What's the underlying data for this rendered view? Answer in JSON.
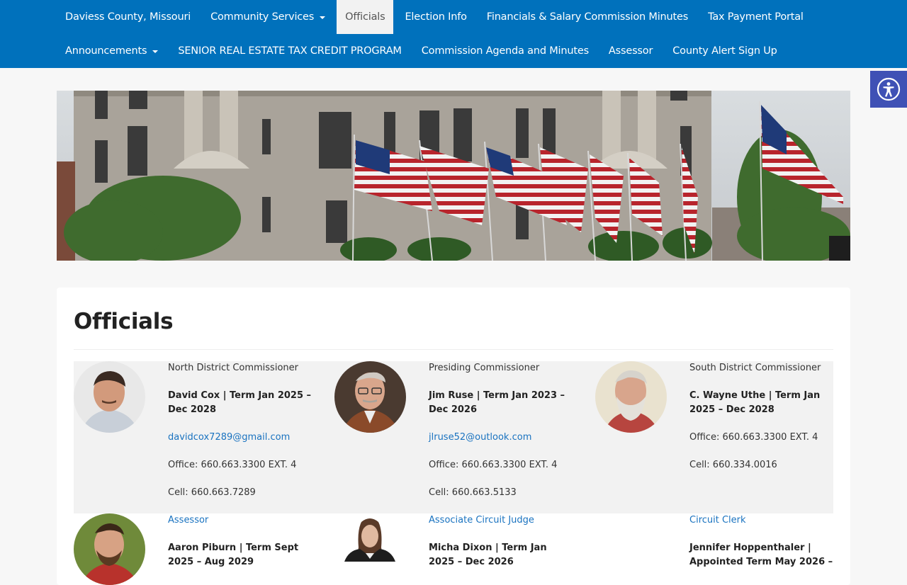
{
  "nav": {
    "row1": [
      {
        "label": "Daviess County, Missouri"
      },
      {
        "label": "Community Services"
      },
      {
        "label": "Officials"
      },
      {
        "label": "Election Info"
      },
      {
        "label": "Financials & Salary Commission Minutes"
      },
      {
        "label": "Tax Payment Portal"
      }
    ],
    "row2": [
      {
        "label": "Announcements"
      },
      {
        "label": "SENIOR REAL ESTATE TAX CREDIT PROGRAM"
      },
      {
        "label": "Commission Agenda and Minutes"
      },
      {
        "label": "Assessor"
      },
      {
        "label": "County Alert Sign Up"
      }
    ]
  },
  "colors": {
    "nav_bg": "#0071bc",
    "link": "#1a73c0",
    "accessibility_bg": "#3f51b5"
  },
  "icons": {
    "accessibility": "accessibility-icon",
    "dropdown": "chevron-down-icon"
  },
  "page": {
    "title": "Officials"
  },
  "officials": [
    {
      "role": "North District Commissioner",
      "name": "David Cox | Term Jan 2025 – Dec 2028",
      "email": "davidcox7289@gmail.com",
      "office": "Office: 660.663.3300 EXT. 4",
      "cell": "Cell: 660.663.7289"
    },
    {
      "role": "Presiding Commissioner",
      "name": "Jim Ruse | Term Jan 2023 – Dec 2026",
      "email": "jlruse52@outlook.com",
      "office": "Office: 660.663.3300 EXT. 4",
      "cell": "Cell: 660.663.5133"
    },
    {
      "role": "South District Commissioner",
      "name": "C. Wayne Uthe | Term Jan 2025 – Dec 2028",
      "office": "Office: 660.663.3300 EXT. 4",
      "cell": "Cell: 660.334.0016"
    },
    {
      "role": "Assessor",
      "name": "Aaron Piburn | Term Sept 2025 – Aug 2029"
    },
    {
      "role": "Associate Circuit Judge",
      "name": "Micha Dixon | Term Jan 2025 – Dec 2026"
    },
    {
      "role": "Circuit Clerk",
      "name": "Jennifer Hoppenthaler | Appointed Term May 2026 –"
    }
  ]
}
